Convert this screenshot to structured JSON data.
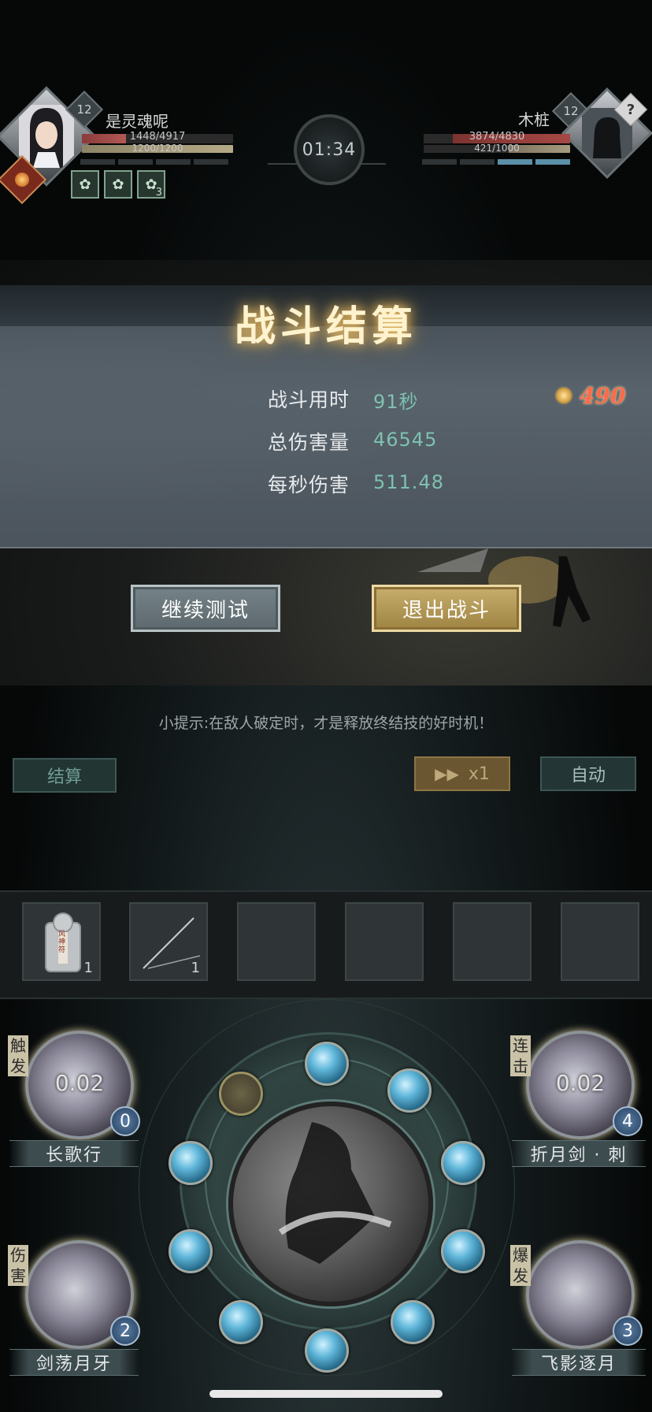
{
  "player": {
    "name": "是灵魂呢",
    "level": "12",
    "hp_text": "1448/4917",
    "hp_fraction": 0.29,
    "mp_text": "1200/1200",
    "mp_fraction": 1.0,
    "buff_stack": "3"
  },
  "enemy": {
    "name": "木桩",
    "level": "12",
    "portrait_symbol": "?",
    "hp_text": "3874/4830",
    "hp_fraction": 0.8,
    "mp_text": "421/1000",
    "mp_fraction": 0.42
  },
  "timer": "01:34",
  "result": {
    "title": "战斗结算",
    "stats": [
      {
        "label": "战斗用时",
        "value": "91秒"
      },
      {
        "label": "总伤害量",
        "value": "46545"
      },
      {
        "label": "每秒伤害",
        "value": "511.48"
      }
    ],
    "reward": "490",
    "continue_label": "继续测试",
    "exit_label": "退出战斗"
  },
  "tip": "小提示:在敌人破定时，才是释放终结技的好时机！",
  "controls": {
    "settle_label": "结算",
    "speed_label": "x1",
    "auto_label": "自动"
  },
  "items": [
    {
      "count": "1",
      "label": "风神符"
    },
    {
      "count": "1"
    },
    {},
    {},
    {},
    {}
  ],
  "skills": {
    "top_left": {
      "tag": "触发",
      "name": "长歌行",
      "cooldown": "0.02",
      "count": "0"
    },
    "top_right": {
      "tag": "连击",
      "name": "折月剑 · 刺",
      "cooldown": "0.02",
      "count": "4"
    },
    "bottom_left": {
      "tag": "伤害",
      "name": "剑荡月牙",
      "count": "2"
    },
    "bottom_right": {
      "tag": "爆发",
      "name": "飞影逐月",
      "count": "3"
    }
  },
  "colors": {
    "accent_gold": "#c7ae6d",
    "hp_red": "#a44a4a",
    "stat_value": "#7ec1b0",
    "reward_red": "#ff6a4a"
  }
}
